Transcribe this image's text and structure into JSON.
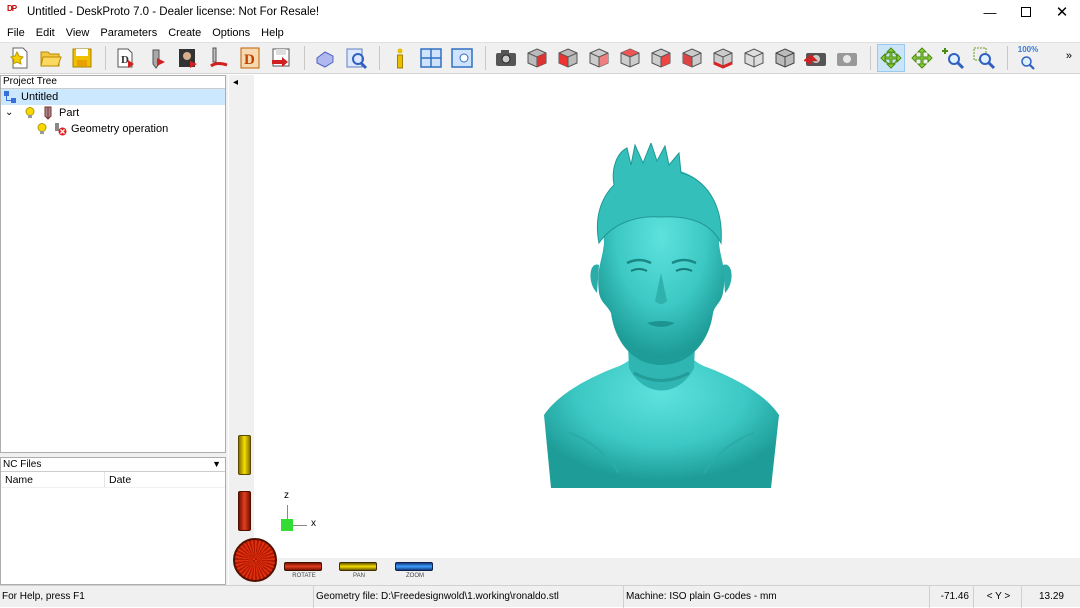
{
  "window": {
    "title": "Untitled - DeskProto 7.0 - Dealer license: Not For Resale!",
    "icon_text": "DP",
    "controls": [
      "minimize-icon",
      "maximize-icon",
      "close-icon"
    ]
  },
  "menu": [
    "File",
    "Edit",
    "View",
    "Parameters",
    "Create",
    "Options",
    "Help"
  ],
  "toolbar": {
    "zoom_label": "100%",
    "overflow": "»",
    "active_tool": "rotate"
  },
  "project_tree": {
    "title": "Project Tree",
    "root": "Untitled",
    "part": "Part",
    "operation": "Geometry operation"
  },
  "nc_files": {
    "title": "NC Files",
    "columns": [
      "Name",
      "Date"
    ]
  },
  "view": {
    "axis_z": "z",
    "axis_x": "x",
    "collapse_arrow": "◂",
    "model_color": "#3cc8c4",
    "sliders": {
      "rotate": "ROTATE",
      "pan": "PAN",
      "zoom": "ZOOM"
    }
  },
  "status": {
    "help": "For Help, press F1",
    "geometry_file": "Geometry file: D:\\Freedesignwold\\1.working\\ronaldo.stl",
    "machine": "Machine: ISO plain G-codes - mm",
    "coord_value": "-71.46",
    "coord_axis": "< Y >",
    "coord_value2": "13.29"
  }
}
